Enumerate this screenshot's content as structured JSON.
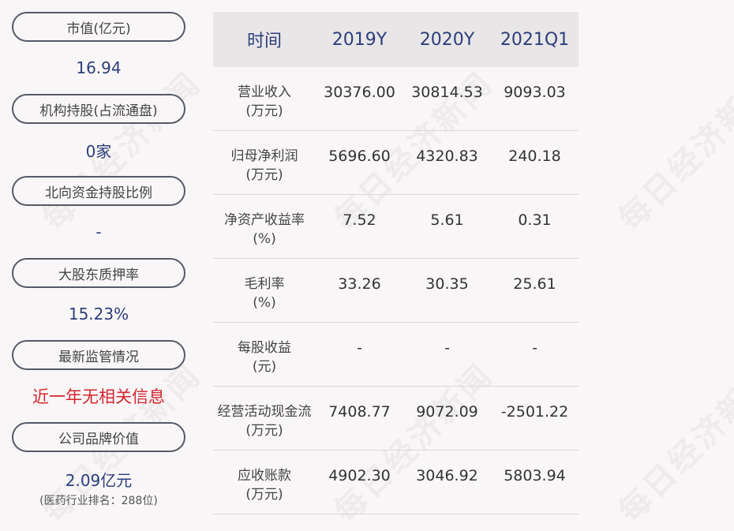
{
  "watermark": "每日经济新闻",
  "left_panel": [
    {
      "label": "市值(亿元)",
      "value": "16.94"
    },
    {
      "label": "机构持股(占流通盘)",
      "value": "0家"
    },
    {
      "label": "北向资金持股比例",
      "value": "-"
    },
    {
      "label": "大股东质押率",
      "value": "15.23%"
    },
    {
      "label": "最新监管情况",
      "value": "近一年无相关信息",
      "highlight": "#d3262e"
    },
    {
      "label": "公司品牌价值",
      "value": "2.09亿元",
      "sub": "(医药行业排名：288位)"
    }
  ],
  "table": {
    "headers": [
      "时间",
      "2019Y",
      "2020Y",
      "2021Q1"
    ],
    "rows": [
      {
        "name": "营业收入",
        "unit": "(万元)",
        "values": [
          "30376.00",
          "30814.53",
          "9093.03"
        ]
      },
      {
        "name": "归母净利润",
        "unit": "(万元)",
        "values": [
          "5696.60",
          "4320.83",
          "240.18"
        ]
      },
      {
        "name": "净资产收益率",
        "unit": "(%)",
        "values": [
          "7.52",
          "5.61",
          "0.31"
        ]
      },
      {
        "name": "毛利率",
        "unit": "(%)",
        "values": [
          "33.26",
          "30.35",
          "25.61"
        ]
      },
      {
        "name": "每股收益",
        "unit": "(元)",
        "values": [
          "-",
          "-",
          "-"
        ]
      },
      {
        "name": "经营活动现金流",
        "unit": "(万元)",
        "values": [
          "7408.77",
          "9072.09",
          "-2501.22"
        ]
      },
      {
        "name": "应收账款",
        "unit": "(万元)",
        "values": [
          "4902.30",
          "3046.92",
          "5803.94"
        ]
      }
    ]
  },
  "colors": {
    "value_blue": "#2c3e7a",
    "alert_red": "#d3262e",
    "header_bg": "#e9e6e8"
  }
}
